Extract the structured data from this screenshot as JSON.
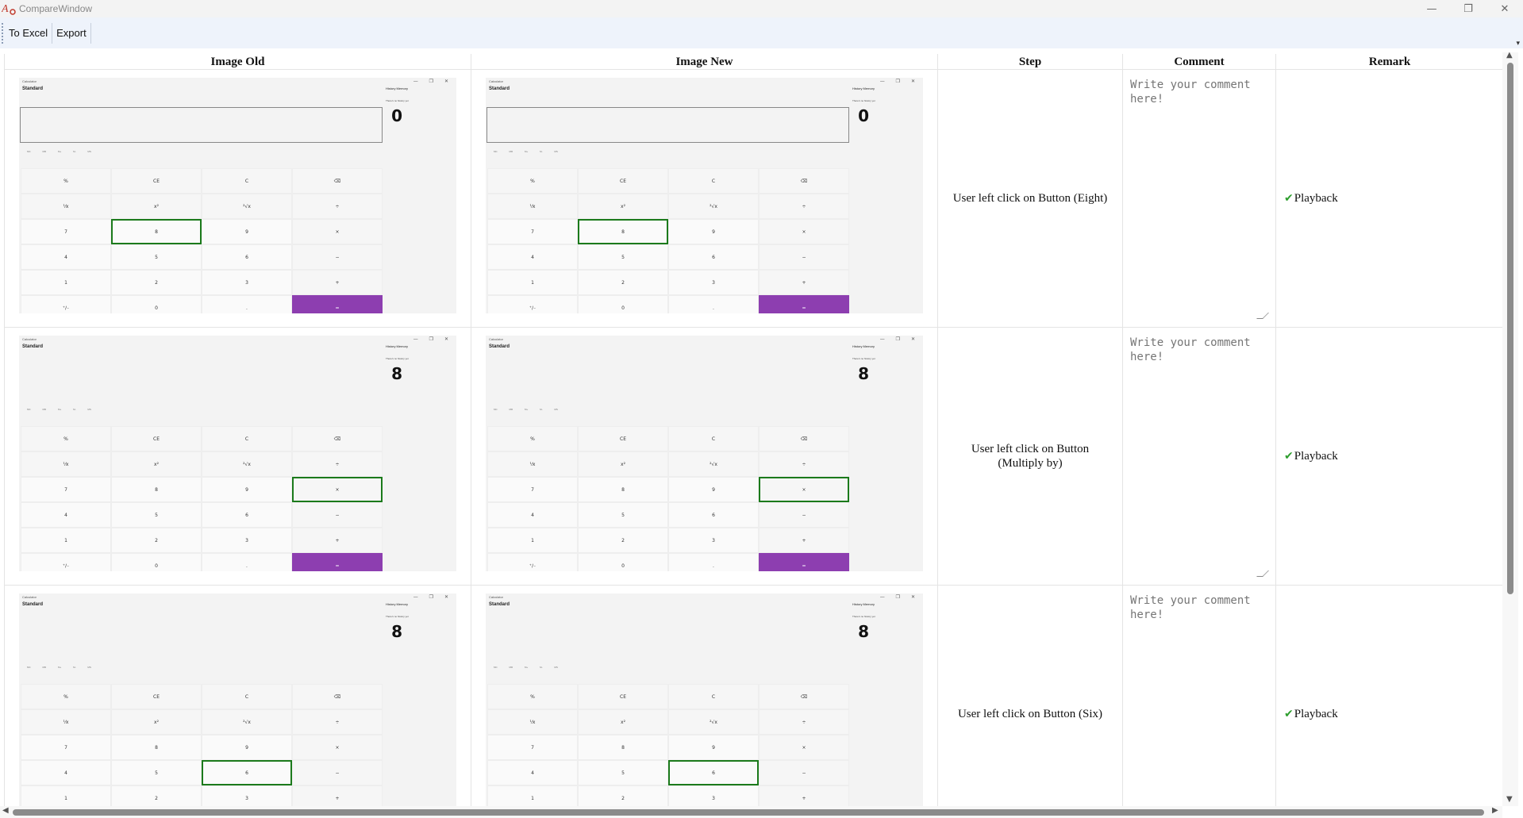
{
  "window": {
    "title": "CompareWindow",
    "minimize": "—",
    "restore": "❐",
    "close": "✕"
  },
  "toolbar": {
    "to_excel": "To Excel",
    "export": "Export"
  },
  "columns": {
    "image_old": "Image Old",
    "image_new": "Image New",
    "step": "Step",
    "comment": "Comment",
    "remark": "Remark"
  },
  "comment_placeholder": "Write your comment here!",
  "remark_label": "Playback",
  "screenshot": {
    "app_title": "Calculator",
    "mode": "Standard",
    "history_tabs": "History   Memory",
    "history_note": "There's no history yet",
    "memory_buttons": "MC MR M+ M- MS",
    "keys": [
      "%",
      "CE",
      "C",
      "⌫",
      "⅟x",
      "x²",
      "²√x",
      "÷",
      "7",
      "8",
      "9",
      "×",
      "4",
      "5",
      "6",
      "−",
      "1",
      "2",
      "3",
      "+",
      "⁺∕₋",
      "0",
      ".",
      "="
    ]
  },
  "rows": [
    {
      "display": "0",
      "step": "User left click on Button (Eight)"
    },
    {
      "display": "8",
      "step": "User left click on Button (Multiply by)"
    },
    {
      "display": "8",
      "step": "User left click on Button (Six)"
    }
  ]
}
